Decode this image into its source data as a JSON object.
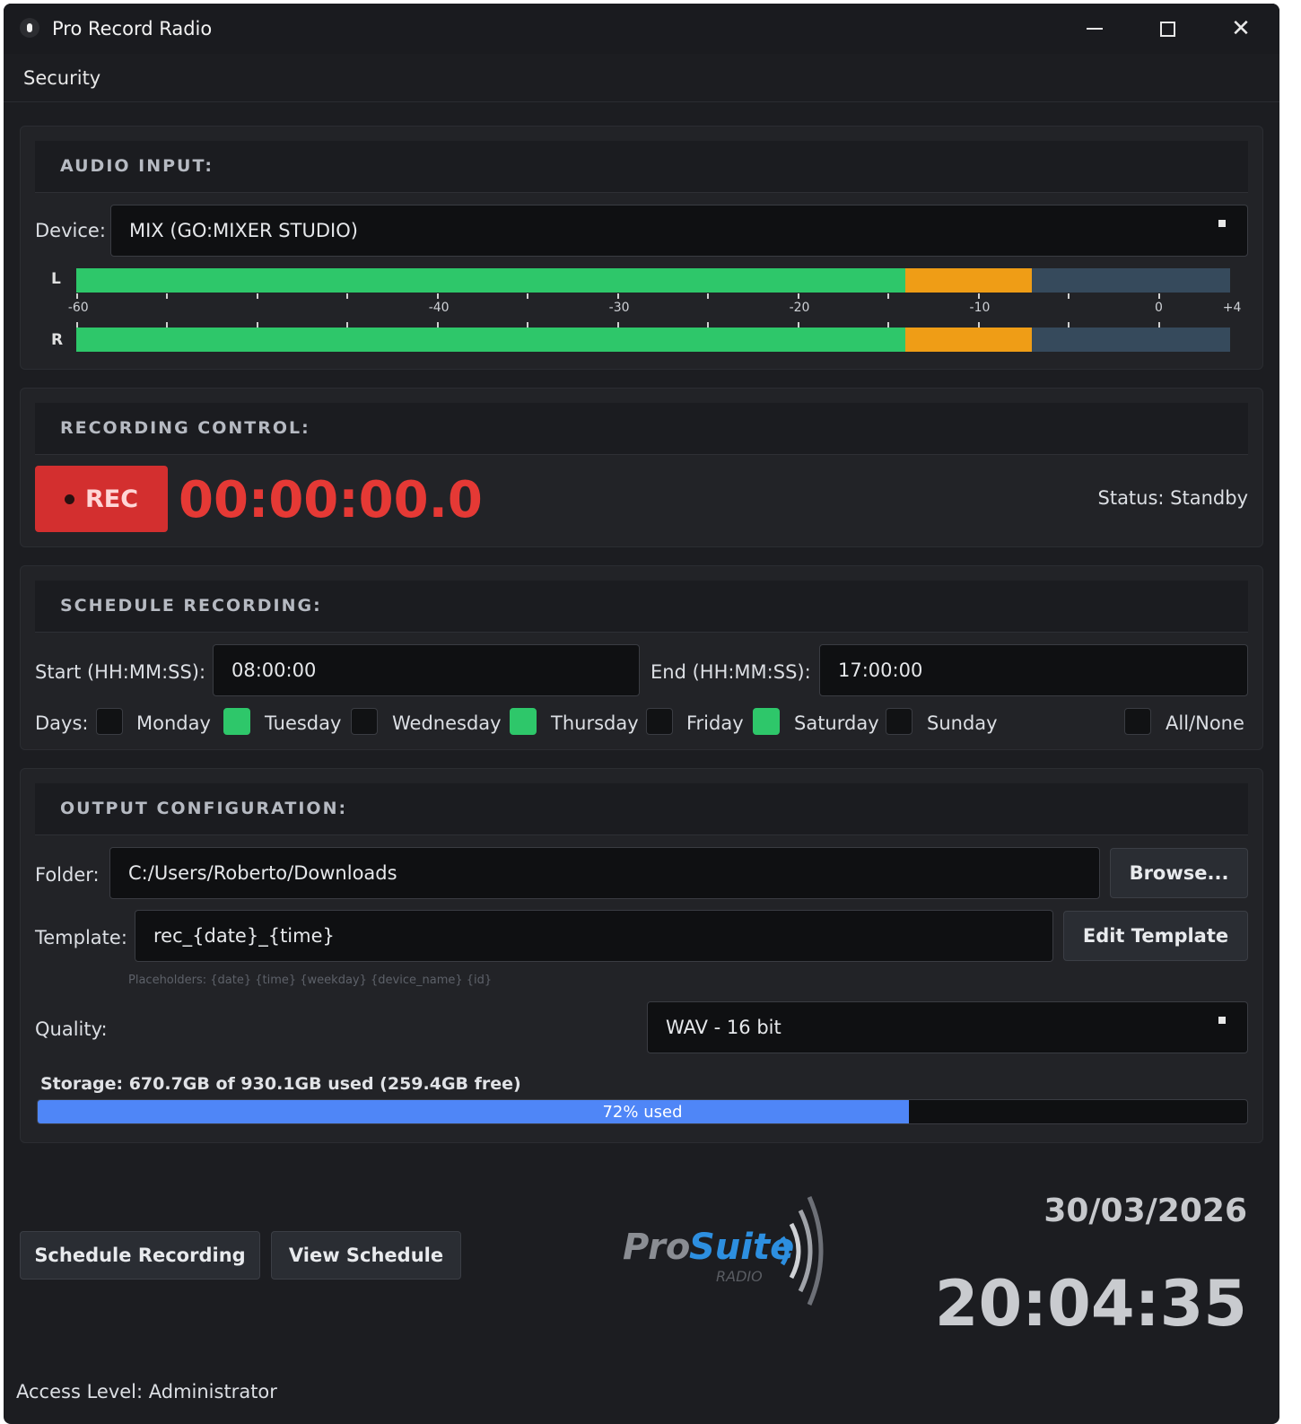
{
  "window": {
    "title": "Pro Record Radio"
  },
  "menu": {
    "items": [
      "Security"
    ]
  },
  "audio_input": {
    "title": "AUDIO INPUT:",
    "device_label": "Device:",
    "device_value": "MIX (GO:MIXER STUDIO)",
    "meters": {
      "left_label": "L",
      "right_label": "R",
      "left_level_db": -7,
      "right_level_db": -7,
      "orange_start_db": -14,
      "scale_min_db": -60,
      "scale_max_db": 4,
      "scale_labels": [
        {
          "db": -60,
          "text": "-60"
        },
        {
          "db": -40,
          "text": "-40"
        },
        {
          "db": -30,
          "text": "-30"
        },
        {
          "db": -20,
          "text": "-20"
        },
        {
          "db": -10,
          "text": "-10"
        },
        {
          "db": 0,
          "text": "0"
        },
        {
          "db": 4,
          "text": "+4"
        }
      ]
    }
  },
  "recording_control": {
    "title": "RECORDING CONTROL:",
    "rec_label": "REC",
    "timer": "00:00:00.0",
    "status": "Status: Standby"
  },
  "schedule": {
    "title": "SCHEDULE RECORDING:",
    "start_label": "Start (HH:MM:SS):",
    "start_value": "08:00:00",
    "end_label": "End (HH:MM:SS):",
    "end_value": "17:00:00",
    "days_label": "Days:",
    "days": [
      {
        "name": "Monday",
        "checked": false
      },
      {
        "name": "Tuesday",
        "checked": true
      },
      {
        "name": "Wednesday",
        "checked": false
      },
      {
        "name": "Thursday",
        "checked": true
      },
      {
        "name": "Friday",
        "checked": false
      },
      {
        "name": "Saturday",
        "checked": true
      },
      {
        "name": "Sunday",
        "checked": false
      }
    ],
    "all_none_label": "All/None",
    "all_none_checked": false
  },
  "output": {
    "title": "OUTPUT CONFIGURATION:",
    "folder_label": "Folder:",
    "folder_value": "C:/Users/Roberto/Downloads",
    "browse_label": "Browse...",
    "template_label": "Template:",
    "template_value": "rec_{date}_{time}",
    "edit_template_label": "Edit Template",
    "placeholders_hint": "Placeholders: {date} {time} {weekday} {device_name} {id}",
    "quality_label": "Quality:",
    "quality_value": "WAV - 16 bit",
    "storage_text": "Storage: 670.7GB of 930.1GB used (259.4GB free)",
    "storage_percent": 72,
    "storage_percent_text": "72% used"
  },
  "footer": {
    "schedule_button": "Schedule Recording",
    "view_schedule_button": "View Schedule",
    "logo_pro": "Pro",
    "logo_suite": "Suite",
    "logo_radio": "RADIO",
    "date": "30/03/2026",
    "time": "20:04:35",
    "access_level": "Access Level: Administrator"
  },
  "colors": {
    "accent_red": "#d32f2f",
    "meter_green": "#2ec76a",
    "meter_orange": "#ef9d16",
    "storage_blue": "#4f86f7"
  }
}
